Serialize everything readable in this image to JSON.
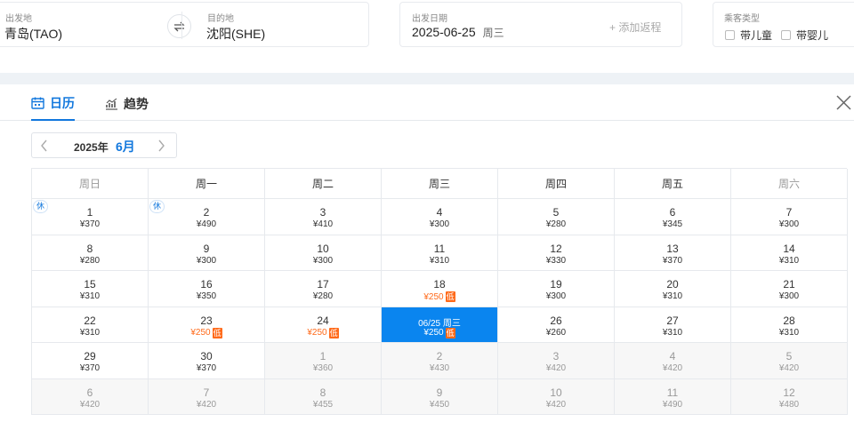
{
  "search": {
    "from_label": "出发地",
    "from_value": "青岛(TAO)",
    "to_label": "目的地",
    "to_value": "沈阳(SHE)",
    "date_label": "出发日期",
    "date_value": "2025-06-25",
    "date_weekday": "周三",
    "add_return": "+ 添加返程",
    "pax_label": "乘客类型",
    "pax_child": "带儿童",
    "pax_infant": "带婴儿"
  },
  "tabs": {
    "calendar": "日历",
    "trend": "趋势"
  },
  "month_nav": {
    "year": "2025年",
    "month": "6月"
  },
  "colors": {
    "accent": "#1177dd",
    "selected": "#0a85ef",
    "low": "#ff6a1a"
  },
  "weekdays": [
    "周日",
    "周一",
    "周二",
    "周三",
    "周四",
    "周五",
    "周六"
  ],
  "days": [
    {
      "d": "1",
      "p": "¥370",
      "hol": "休"
    },
    {
      "d": "2",
      "p": "¥490",
      "hol": "休"
    },
    {
      "d": "3",
      "p": "¥410"
    },
    {
      "d": "4",
      "p": "¥300"
    },
    {
      "d": "5",
      "p": "¥280"
    },
    {
      "d": "6",
      "p": "¥345"
    },
    {
      "d": "7",
      "p": "¥300"
    },
    {
      "d": "8",
      "p": "¥280"
    },
    {
      "d": "9",
      "p": "¥300"
    },
    {
      "d": "10",
      "p": "¥300"
    },
    {
      "d": "11",
      "p": "¥310"
    },
    {
      "d": "12",
      "p": "¥330"
    },
    {
      "d": "13",
      "p": "¥370"
    },
    {
      "d": "14",
      "p": "¥310"
    },
    {
      "d": "15",
      "p": "¥310"
    },
    {
      "d": "16",
      "p": "¥350"
    },
    {
      "d": "17",
      "p": "¥280"
    },
    {
      "d": "18",
      "p": "¥250",
      "low": "低"
    },
    {
      "d": "19",
      "p": "¥300"
    },
    {
      "d": "20",
      "p": "¥310"
    },
    {
      "d": "21",
      "p": "¥300"
    },
    {
      "d": "22",
      "p": "¥310"
    },
    {
      "d": "23",
      "p": "¥250",
      "low": "低"
    },
    {
      "d": "24",
      "p": "¥250",
      "low": "低"
    },
    {
      "d": "06/25 周三",
      "p": "¥250",
      "low": "低",
      "sel": true
    },
    {
      "d": "26",
      "p": "¥260"
    },
    {
      "d": "27",
      "p": "¥310"
    },
    {
      "d": "28",
      "p": "¥310"
    },
    {
      "d": "29",
      "p": "¥370"
    },
    {
      "d": "30",
      "p": "¥370"
    },
    {
      "d": "1",
      "p": "¥360",
      "other": true
    },
    {
      "d": "2",
      "p": "¥430",
      "other": true
    },
    {
      "d": "3",
      "p": "¥420",
      "other": true
    },
    {
      "d": "4",
      "p": "¥420",
      "other": true
    },
    {
      "d": "5",
      "p": "¥420",
      "other": true
    },
    {
      "d": "6",
      "p": "¥420",
      "other": true
    },
    {
      "d": "7",
      "p": "¥420",
      "other": true
    },
    {
      "d": "8",
      "p": "¥455",
      "other": true
    },
    {
      "d": "9",
      "p": "¥450",
      "other": true
    },
    {
      "d": "10",
      "p": "¥420",
      "other": true
    },
    {
      "d": "11",
      "p": "¥490",
      "other": true
    },
    {
      "d": "12",
      "p": "¥480",
      "other": true
    }
  ]
}
